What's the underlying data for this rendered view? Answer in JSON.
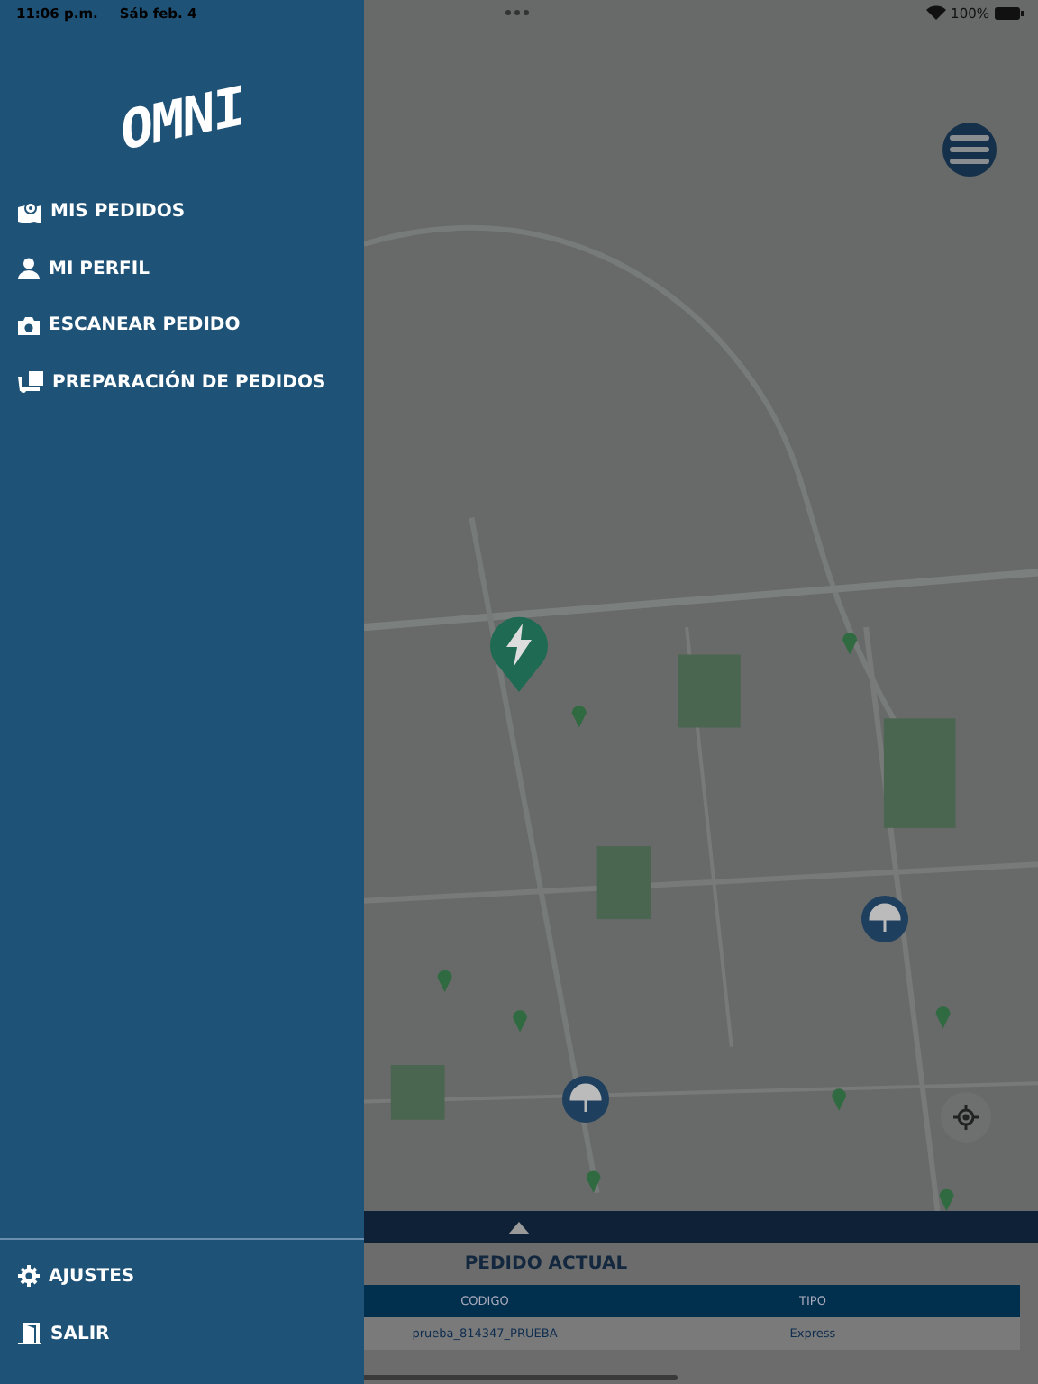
{
  "status_bar": {
    "time": "11:06 p.m.",
    "date": "Sáb feb. 4",
    "battery": "100%"
  },
  "sidebar": {
    "logo": "OMNI",
    "items": [
      {
        "label": "MIS PEDIDOS",
        "kind": "map"
      },
      {
        "label": "MI PERFIL",
        "kind": "user"
      },
      {
        "label": "ESCANEAR PEDIDO",
        "kind": "camera"
      },
      {
        "label": "PREPARACIÓN DE PEDIDOS",
        "kind": "dolly"
      }
    ],
    "footer_items": [
      {
        "label": "AJUSTES",
        "kind": "gear"
      },
      {
        "label": "SALIR",
        "kind": "exit"
      }
    ]
  },
  "current_order": {
    "title": "PEDIDO ACTUAL",
    "table": {
      "columns": [
        "CODIGO",
        "TIPO"
      ],
      "rows": [
        [
          "prueba_814347_PRUEBA",
          "Express"
        ]
      ]
    }
  }
}
